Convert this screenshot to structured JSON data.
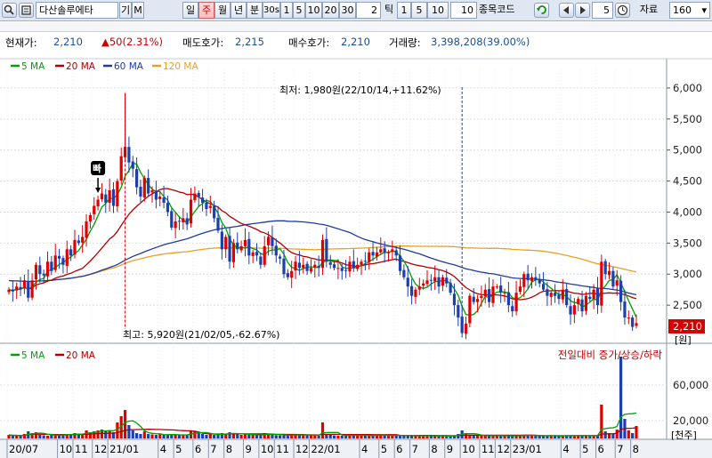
{
  "toolbar": {
    "code_value": "다산솔루에타",
    "btn_gi": "기",
    "btn_m": "M",
    "period_day": "일",
    "period_week": "주",
    "period_month": "월",
    "period_year": "년",
    "period_min": "분",
    "sec30": "30s",
    "min_buttons": [
      "1",
      "5",
      "10",
      "20",
      "30"
    ],
    "min_input": "2",
    "tick_label": "틱",
    "tick_buttons": [
      "1",
      "5",
      "10"
    ],
    "tick_input": "10",
    "stock_code_label": "종목코드",
    "count_input": "5",
    "data_label": "자료",
    "data_count": "160"
  },
  "info": {
    "current_label": "현재가:",
    "current_value": "2,210",
    "change": "▲50(2.31%)",
    "ask_label": "매도호가:",
    "ask_value": "2,215",
    "bid_label": "매수호가:",
    "bid_value": "2,210",
    "volume_label": "거래량:",
    "volume_value": "3,398,208(39.00%)"
  },
  "colors": {
    "up": "#e00000",
    "down": "#1b3fae",
    "ma5": "#00a000",
    "ma20": "#b00000",
    "ma60": "#1f3c9c",
    "ma120": "#e8a020"
  },
  "chart_data": {
    "type": "candlestick",
    "price_panel": {
      "y_ticks": [
        "6,000",
        "5,500",
        "5,000",
        "4,500",
        "4,000",
        "3,500",
        "3,000",
        "2,500"
      ],
      "ylim": [
        2000,
        6300
      ],
      "current_price_label": "2,210",
      "unit_label": "[원]",
      "legend": [
        "5 MA",
        "20 MA",
        "60 MA",
        "120 MA"
      ],
      "annotation_low": "최저: 1,980원(22/10/14,+11.62%)",
      "annotation_high": "최고: 5,920원(21/02/05,-62.67%)",
      "marker_label": "빠"
    },
    "volume_panel": {
      "y_ticks": [
        "60,000",
        "20,000"
      ],
      "unit_label": "[천주]",
      "legend": [
        "5 MA",
        "20 MA"
      ],
      "title": "전일대비 증가/상승/하락"
    },
    "x_tick_labels": [
      "20/07",
      "10",
      "11",
      "12",
      "21/01",
      "4",
      "5",
      "6",
      "7",
      "8",
      "9",
      "10",
      "11",
      "12",
      "22/01",
      "4",
      "5",
      "6",
      "7",
      "8",
      "9",
      "10",
      "11",
      "12",
      "23/01",
      "4",
      "5",
      "6",
      "7",
      "8"
    ],
    "x_tick_weeks": [
      0,
      13,
      17,
      22,
      26,
      39,
      43,
      48,
      52,
      56,
      61,
      65,
      69,
      74,
      78,
      91,
      96,
      100,
      104,
      109,
      113,
      117,
      122,
      126,
      130,
      143,
      148,
      152,
      157,
      161
    ],
    "low_week": 117,
    "high_week": 30,
    "marker_week": 23,
    "weeks": 163,
    "closes": [
      2750,
      2720,
      2800,
      2760,
      2900,
      2620,
      2900,
      3150,
      3000,
      2980,
      3200,
      3050,
      3300,
      3250,
      3150,
      3400,
      3300,
      3550,
      3500,
      3600,
      3850,
      3950,
      4100,
      4200,
      4300,
      4150,
      4350,
      4100,
      4500,
      4900,
      5050,
      4800,
      4700,
      4400,
      4250,
      4550,
      4300,
      4350,
      4200,
      4250,
      4150,
      4000,
      3750,
      3850,
      3850,
      3900,
      3800,
      4200,
      4300,
      4250,
      4150,
      4050,
      4100,
      3900,
      3700,
      3400,
      3600,
      3200,
      3500,
      3400,
      3450,
      3550,
      3300,
      3350,
      3300,
      3150,
      3450,
      3600,
      3450,
      3300,
      3250,
      3000,
      2950,
      3050,
      3200,
      3100,
      3150,
      3050,
      3100,
      3150,
      3100,
      3550,
      3200,
      3150,
      3100,
      3100,
      3050,
      3050,
      3200,
      3100,
      3150,
      3200,
      3200,
      3350,
      3300,
      3350,
      3400,
      3350,
      3350,
      3400,
      3300,
      3050,
      2950,
      2800,
      2650,
      2750,
      2800,
      2850,
      2900,
      2900,
      2950,
      2800,
      2950,
      2850,
      2700,
      2500,
      2300,
      2050,
      2200,
      2650,
      2550,
      2600,
      2650,
      2750,
      2550,
      2800,
      2800,
      2700,
      2700,
      2500,
      2400,
      2700,
      2800,
      3000,
      2900,
      2950,
      2900,
      2850,
      2750,
      2650,
      2700,
      2650,
      2600,
      2750,
      2500,
      2350,
      2500,
      2600,
      2400,
      2650,
      2600,
      2750,
      2500,
      3200,
      3000,
      3050,
      2800,
      2900,
      2550,
      2300,
      2300,
      2150,
      2210
    ],
    "volume": [
      4000,
      3000,
      3500,
      2500,
      5000,
      8000,
      6000,
      7000,
      4000,
      3500,
      3000,
      4000,
      3500,
      4500,
      4000,
      5000,
      4000,
      6000,
      5000,
      4500,
      9000,
      7000,
      8000,
      9000,
      10000,
      8000,
      9000,
      7000,
      18000,
      25000,
      32000,
      15000,
      9000,
      6000,
      5000,
      8000,
      5000,
      4500,
      4000,
      4500,
      4000,
      4000,
      5000,
      4000,
      3500,
      3500,
      4000,
      9000,
      8000,
      7000,
      5000,
      4000,
      4500,
      4000,
      5000,
      6000,
      5000,
      7000,
      5000,
      4500,
      4000,
      5000,
      4000,
      4000,
      3500,
      3500,
      6000,
      5000,
      4000,
      3500,
      3500,
      4000,
      3500,
      3500,
      5000,
      4000,
      3500,
      3500,
      3500,
      3500,
      3000,
      18000,
      5000,
      4000,
      3500,
      3000,
      3000,
      3000,
      4500,
      3500,
      3000,
      3000,
      3000,
      4000,
      3500,
      3500,
      4000,
      3500,
      3000,
      3000,
      3500,
      4000,
      3500,
      3000,
      3000,
      3000,
      3000,
      3000,
      3000,
      3000,
      3000,
      2500,
      3000,
      2500,
      3000,
      3500,
      5000,
      9000,
      6000,
      3500,
      3000,
      3000,
      3000,
      3000,
      3000,
      3500,
      3000,
      3000,
      3000,
      2500,
      3000,
      3500,
      3000,
      4000,
      3500,
      3000,
      3000,
      3000,
      3000,
      3000,
      3000,
      3000,
      2500,
      3000,
      3500,
      3500,
      3000,
      3000,
      3000,
      3500,
      3000,
      3500,
      3000,
      38000,
      8000,
      6000,
      5000,
      10000,
      92000,
      22000,
      9000,
      6000,
      14000
    ]
  }
}
